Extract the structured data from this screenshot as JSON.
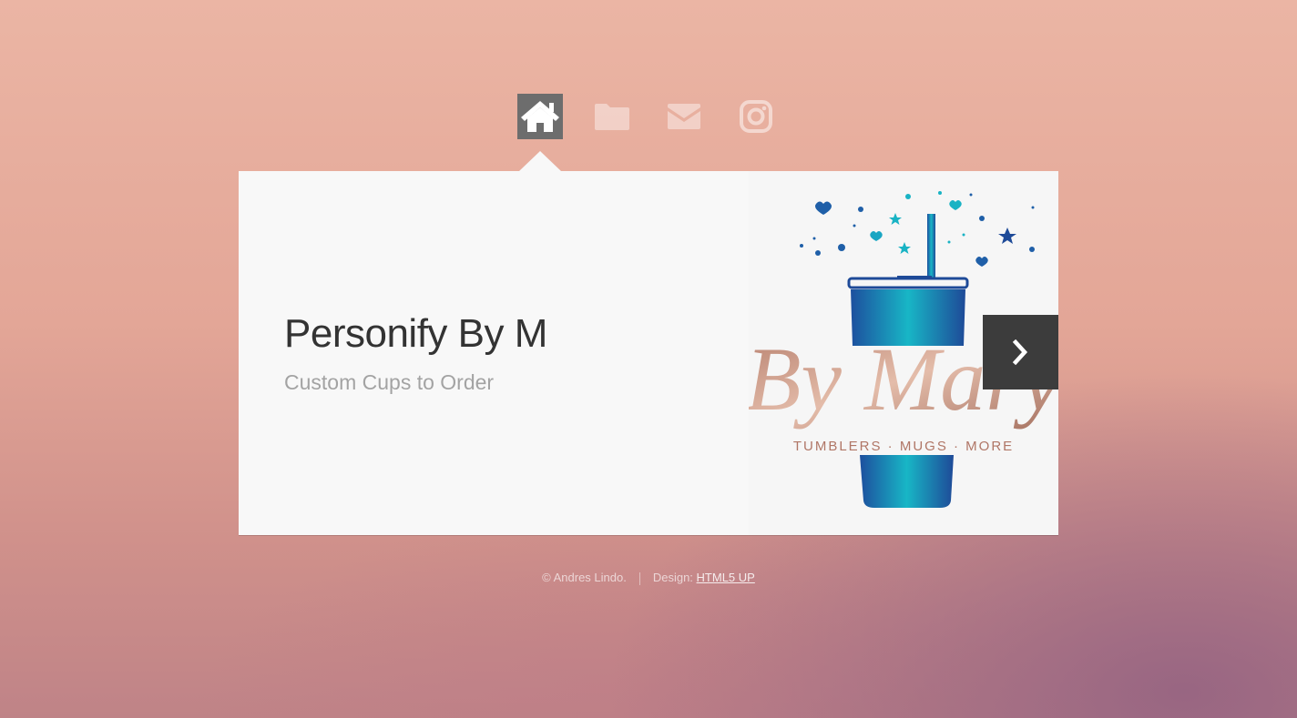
{
  "nav": {
    "items": [
      {
        "icon": "home-icon",
        "active": true
      },
      {
        "icon": "folder-icon",
        "active": false
      },
      {
        "icon": "envelope-icon",
        "active": false
      },
      {
        "icon": "instagram-icon",
        "active": false
      }
    ]
  },
  "main": {
    "title": "Personify By M",
    "subtitle": "Custom Cups to Order",
    "logo": {
      "script_text": "By Mary",
      "tagline": "TUMBLERS · MUGS · MORE"
    },
    "next_icon": "chevron-right-icon"
  },
  "footer": {
    "copyright": "© Andres Lindo.",
    "design_label": "Design:",
    "design_link": "HTML5 UP"
  },
  "colors": {
    "accent_blue": "#1f5fa8",
    "accent_teal": "#19b3c4",
    "rose_gold": "#c48a76",
    "panel": "#f8f8f8",
    "nav_active": "#6d6d6d"
  }
}
